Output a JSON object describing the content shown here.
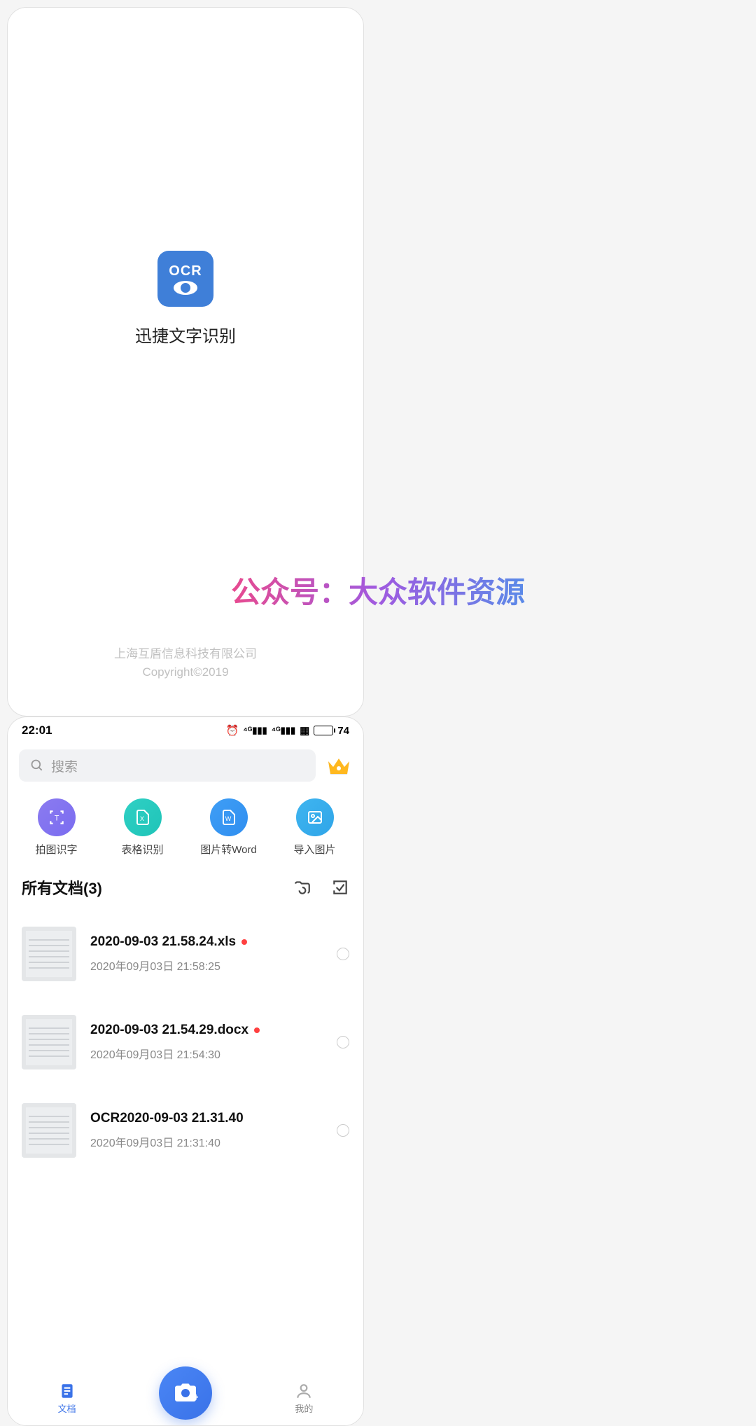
{
  "splash": {
    "logo_text": "OCR",
    "app_name": "迅捷文字识别",
    "company": "上海互盾信息科技有限公司",
    "copyright": "Copyright©2019"
  },
  "status": {
    "time": "22:01",
    "battery": "74"
  },
  "search": {
    "placeholder": "搜索"
  },
  "actions": {
    "scan_text": "拍图识字",
    "table_ocr": "表格识别",
    "to_word": "图片转Word",
    "import_img": "导入图片",
    "partial": "导入"
  },
  "section": {
    "title": "所有文档(3)"
  },
  "docs": [
    {
      "title": "2020-09-03 21.58.24.xls",
      "time": "2020年09月03日 21:58:25",
      "is_new": true
    },
    {
      "title": "2020-09-03 21.54.29.docx",
      "time": "2020年09月03日 21:54:30",
      "is_new": true
    },
    {
      "title": "OCR2020-09-03 21.31.40",
      "time": "2020年09月03日 21:31:40",
      "is_new": false
    }
  ],
  "nav": {
    "docs": "文档",
    "mine": "我的"
  },
  "watermark": "公众号：大众软件资源"
}
